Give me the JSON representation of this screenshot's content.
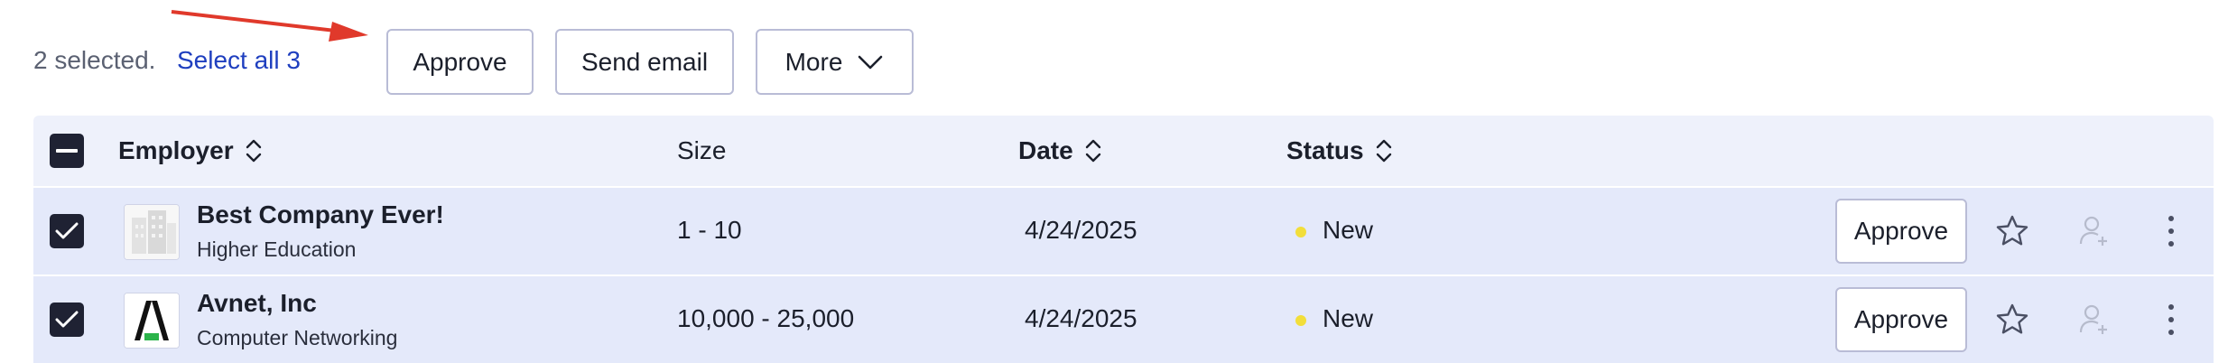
{
  "selection": {
    "count_text": "2 selected.",
    "select_all_link": "Select all 3"
  },
  "bulk_actions": {
    "approve_label": "Approve",
    "send_email_label": "Send email",
    "more_label": "More"
  },
  "table": {
    "columns": [
      {
        "label": "Employer",
        "sortable": true
      },
      {
        "label": "Size",
        "sortable": false
      },
      {
        "label": "Date",
        "sortable": true
      },
      {
        "label": "Status",
        "sortable": true
      }
    ],
    "rows": [
      {
        "checked": true,
        "employer": "Best Company Ever!",
        "industry": "Higher Education",
        "logo": "building-placeholder-logo",
        "size": "1 - 10",
        "date": "4/24/2025",
        "status": "New",
        "approve_label": "Approve"
      },
      {
        "checked": true,
        "employer": "Avnet, Inc",
        "industry": "Computer Networking",
        "logo": "avnet-logo",
        "size": "10,000 - 25,000",
        "date": "4/24/2025",
        "status": "New",
        "approve_label": "Approve"
      }
    ]
  },
  "colors": {
    "accent_link": "#1f3fbf",
    "status_new": "#f2de3a",
    "row_selected_bg": "#e4e9fa",
    "header_bg": "#eef1fb",
    "annotation_arrow": "#e0392b"
  },
  "icons": {
    "sort": "sort-updown-icon",
    "more_dropdown": "chevron-down-icon",
    "favorite": "star-outline-icon",
    "assign": "person-add-icon",
    "row_menu": "kebab-menu-icon"
  }
}
